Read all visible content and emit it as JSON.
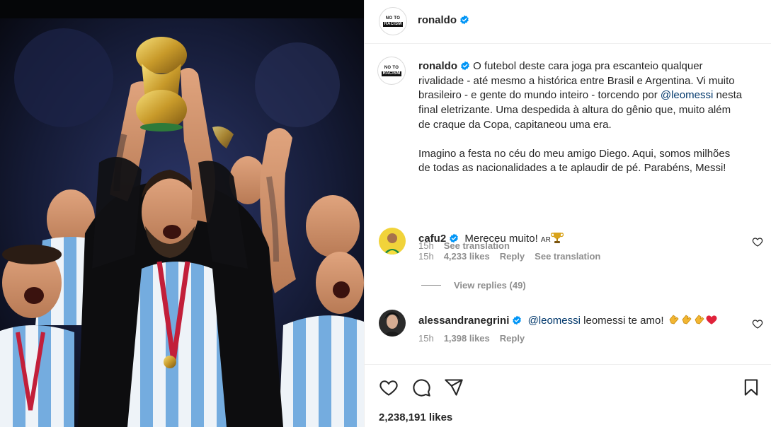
{
  "post": {
    "username": "ronaldo",
    "avatar_logo": {
      "line1": "NO TO",
      "line2": "RACISM"
    },
    "caption": {
      "para1_pre": "O futebol deste cara joga pra escanteio qualquer rivalidade - até mesmo a histórica entre Brasil e Argentina. Vi muito brasileiro - e gente do mundo inteiro - torcendo por ",
      "mention": "@leomessi",
      "para1_post": " nesta final eletrizante. Uma despedida à altura do gênio que, muito além de craque da Copa, capitaneou uma era.",
      "para2": "Imagino a festa no céu do meu amigo Diego. Aqui, somos milhões de todas as nacionalidades a te aplaudir de pé. Parabéns, Messi!",
      "time": "15h",
      "see_translation": "See translation"
    },
    "likes": "2,238,191 likes"
  },
  "comments": [
    {
      "username": "cafu2",
      "text": "Mereceu muito! ",
      "flag_text": "AR",
      "time": "15h",
      "likes": "4,233 likes",
      "reply": "Reply",
      "see_translation": "See translation",
      "view_replies": "View replies (49)"
    },
    {
      "username": "alessandranegrini",
      "mention": "@leomessi",
      "text": " leomessi te amo! ",
      "time": "15h",
      "likes": "1,398 likes",
      "reply": "Reply"
    }
  ],
  "icons": {
    "verified": "verified-badge-icon",
    "like": "heart-icon",
    "comment": "comment-icon",
    "share": "share-icon",
    "save": "bookmark-icon"
  },
  "colors": {
    "verified": "#0095f6",
    "mention": "#00376b",
    "secondary_text": "#8e8e8e",
    "heart_red": "#ed4956"
  }
}
